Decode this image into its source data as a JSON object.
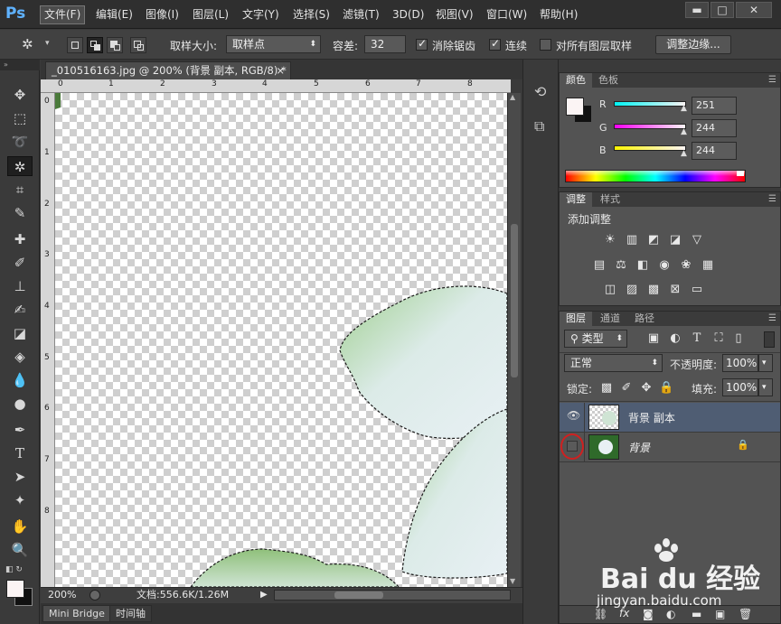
{
  "app": {
    "logo": "Ps"
  },
  "menu": [
    "文件(F)",
    "编辑(E)",
    "图像(I)",
    "图层(L)",
    "文字(Y)",
    "选择(S)",
    "滤镜(T)",
    "3D(D)",
    "视图(V)",
    "窗口(W)",
    "帮助(H)"
  ],
  "window_controls": {
    "minimize": "▬",
    "maximize": "□",
    "close": "✕"
  },
  "options": {
    "sample_size_label": "取样大小:",
    "sample_size_value": "取样点",
    "tolerance_label": "容差:",
    "tolerance_value": "32",
    "anti_alias": "消除锯齿",
    "contiguous": "连续",
    "sample_all": "对所有图层取样",
    "refine_edge": "调整边缘..."
  },
  "document": {
    "tab_title": "_010516163.jpg @ 200% (背景 副本, RGB/8) *",
    "close": "×",
    "ruler_top": [
      "0",
      "1",
      "2",
      "3",
      "4",
      "5",
      "6",
      "7",
      "8"
    ],
    "ruler_left": [
      "0",
      "1",
      "2",
      "3",
      "4",
      "5",
      "6",
      "7",
      "8"
    ],
    "zoom": "200%",
    "doc_size": "文档:556.6K/1.26M"
  },
  "bottom_tabs": [
    "Mini Bridge",
    "时间轴"
  ],
  "color_panel": {
    "tabs": [
      "颜色",
      "色板"
    ],
    "channels": [
      {
        "label": "R",
        "value": "251"
      },
      {
        "label": "G",
        "value": "244"
      },
      {
        "label": "B",
        "value": "244"
      }
    ]
  },
  "adjust_panel": {
    "tabs": [
      "调整",
      "样式"
    ],
    "title": "添加调整"
  },
  "layers_panel": {
    "tabs": [
      "图层",
      "通道",
      "路径"
    ],
    "filter_kind": "类型",
    "blend_mode": "正常",
    "opacity_label": "不透明度:",
    "opacity_value": "100%",
    "lock_label": "锁定:",
    "fill_label": "填充:",
    "fill_value": "100%",
    "layers": [
      {
        "name": "背景 副本",
        "visible": true,
        "selected": true
      },
      {
        "name": "背景",
        "visible": false,
        "selected": false,
        "locked": true
      }
    ]
  },
  "watermark": {
    "brand": "Bai du 经验",
    "url": "jingyan.baidu.com"
  },
  "colors": {
    "accent": "#5fb2ff",
    "selected_layer": "#4f5d73",
    "annotation": "#d02020"
  }
}
